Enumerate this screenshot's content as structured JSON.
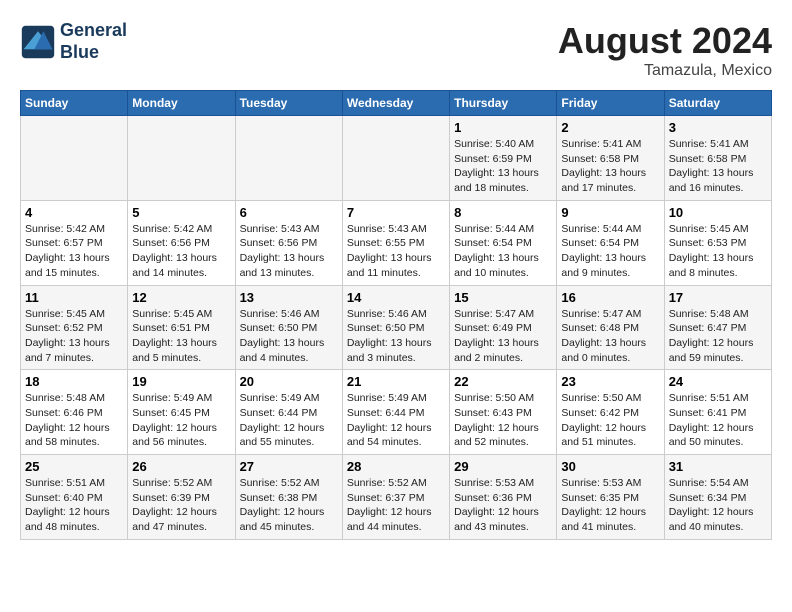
{
  "header": {
    "logo_line1": "General",
    "logo_line2": "Blue",
    "month": "August 2024",
    "location": "Tamazula, Mexico"
  },
  "weekdays": [
    "Sunday",
    "Monday",
    "Tuesday",
    "Wednesday",
    "Thursday",
    "Friday",
    "Saturday"
  ],
  "weeks": [
    [
      {
        "day": "",
        "info": ""
      },
      {
        "day": "",
        "info": ""
      },
      {
        "day": "",
        "info": ""
      },
      {
        "day": "",
        "info": ""
      },
      {
        "day": "1",
        "info": "Sunrise: 5:40 AM\nSunset: 6:59 PM\nDaylight: 13 hours\nand 18 minutes."
      },
      {
        "day": "2",
        "info": "Sunrise: 5:41 AM\nSunset: 6:58 PM\nDaylight: 13 hours\nand 17 minutes."
      },
      {
        "day": "3",
        "info": "Sunrise: 5:41 AM\nSunset: 6:58 PM\nDaylight: 13 hours\nand 16 minutes."
      }
    ],
    [
      {
        "day": "4",
        "info": "Sunrise: 5:42 AM\nSunset: 6:57 PM\nDaylight: 13 hours\nand 15 minutes."
      },
      {
        "day": "5",
        "info": "Sunrise: 5:42 AM\nSunset: 6:56 PM\nDaylight: 13 hours\nand 14 minutes."
      },
      {
        "day": "6",
        "info": "Sunrise: 5:43 AM\nSunset: 6:56 PM\nDaylight: 13 hours\nand 13 minutes."
      },
      {
        "day": "7",
        "info": "Sunrise: 5:43 AM\nSunset: 6:55 PM\nDaylight: 13 hours\nand 11 minutes."
      },
      {
        "day": "8",
        "info": "Sunrise: 5:44 AM\nSunset: 6:54 PM\nDaylight: 13 hours\nand 10 minutes."
      },
      {
        "day": "9",
        "info": "Sunrise: 5:44 AM\nSunset: 6:54 PM\nDaylight: 13 hours\nand 9 minutes."
      },
      {
        "day": "10",
        "info": "Sunrise: 5:45 AM\nSunset: 6:53 PM\nDaylight: 13 hours\nand 8 minutes."
      }
    ],
    [
      {
        "day": "11",
        "info": "Sunrise: 5:45 AM\nSunset: 6:52 PM\nDaylight: 13 hours\nand 7 minutes."
      },
      {
        "day": "12",
        "info": "Sunrise: 5:45 AM\nSunset: 6:51 PM\nDaylight: 13 hours\nand 5 minutes."
      },
      {
        "day": "13",
        "info": "Sunrise: 5:46 AM\nSunset: 6:50 PM\nDaylight: 13 hours\nand 4 minutes."
      },
      {
        "day": "14",
        "info": "Sunrise: 5:46 AM\nSunset: 6:50 PM\nDaylight: 13 hours\nand 3 minutes."
      },
      {
        "day": "15",
        "info": "Sunrise: 5:47 AM\nSunset: 6:49 PM\nDaylight: 13 hours\nand 2 minutes."
      },
      {
        "day": "16",
        "info": "Sunrise: 5:47 AM\nSunset: 6:48 PM\nDaylight: 13 hours\nand 0 minutes."
      },
      {
        "day": "17",
        "info": "Sunrise: 5:48 AM\nSunset: 6:47 PM\nDaylight: 12 hours\nand 59 minutes."
      }
    ],
    [
      {
        "day": "18",
        "info": "Sunrise: 5:48 AM\nSunset: 6:46 PM\nDaylight: 12 hours\nand 58 minutes."
      },
      {
        "day": "19",
        "info": "Sunrise: 5:49 AM\nSunset: 6:45 PM\nDaylight: 12 hours\nand 56 minutes."
      },
      {
        "day": "20",
        "info": "Sunrise: 5:49 AM\nSunset: 6:44 PM\nDaylight: 12 hours\nand 55 minutes."
      },
      {
        "day": "21",
        "info": "Sunrise: 5:49 AM\nSunset: 6:44 PM\nDaylight: 12 hours\nand 54 minutes."
      },
      {
        "day": "22",
        "info": "Sunrise: 5:50 AM\nSunset: 6:43 PM\nDaylight: 12 hours\nand 52 minutes."
      },
      {
        "day": "23",
        "info": "Sunrise: 5:50 AM\nSunset: 6:42 PM\nDaylight: 12 hours\nand 51 minutes."
      },
      {
        "day": "24",
        "info": "Sunrise: 5:51 AM\nSunset: 6:41 PM\nDaylight: 12 hours\nand 50 minutes."
      }
    ],
    [
      {
        "day": "25",
        "info": "Sunrise: 5:51 AM\nSunset: 6:40 PM\nDaylight: 12 hours\nand 48 minutes."
      },
      {
        "day": "26",
        "info": "Sunrise: 5:52 AM\nSunset: 6:39 PM\nDaylight: 12 hours\nand 47 minutes."
      },
      {
        "day": "27",
        "info": "Sunrise: 5:52 AM\nSunset: 6:38 PM\nDaylight: 12 hours\nand 45 minutes."
      },
      {
        "day": "28",
        "info": "Sunrise: 5:52 AM\nSunset: 6:37 PM\nDaylight: 12 hours\nand 44 minutes."
      },
      {
        "day": "29",
        "info": "Sunrise: 5:53 AM\nSunset: 6:36 PM\nDaylight: 12 hours\nand 43 minutes."
      },
      {
        "day": "30",
        "info": "Sunrise: 5:53 AM\nSunset: 6:35 PM\nDaylight: 12 hours\nand 41 minutes."
      },
      {
        "day": "31",
        "info": "Sunrise: 5:54 AM\nSunset: 6:34 PM\nDaylight: 12 hours\nand 40 minutes."
      }
    ]
  ]
}
